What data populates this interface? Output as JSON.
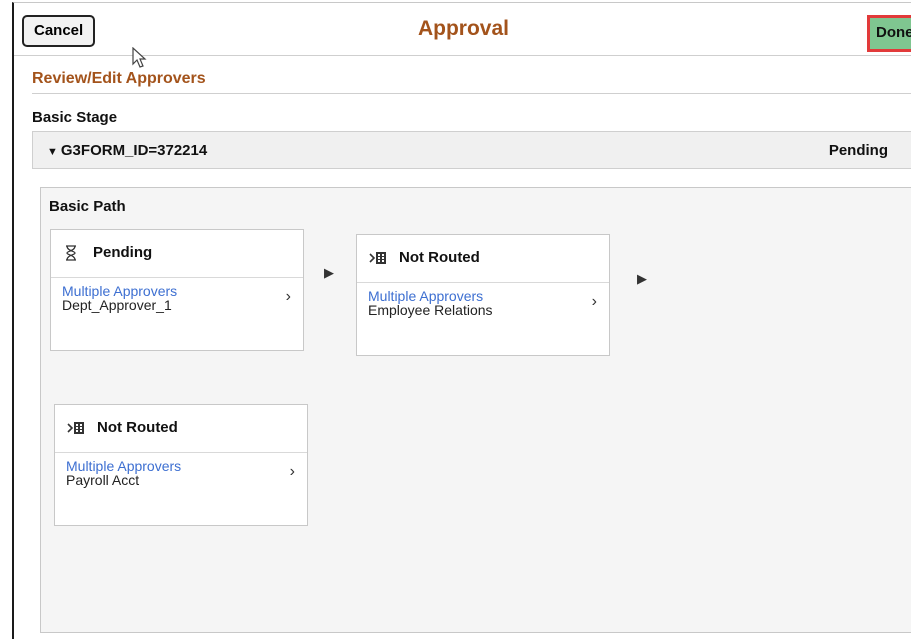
{
  "header": {
    "cancel_label": "Cancel",
    "title": "Approval",
    "done_label": "Done"
  },
  "section_title": "Review/Edit Approvers",
  "stage": {
    "label": "Basic Stage",
    "group": {
      "id_label": "G3FORM_ID=372214",
      "status": "Pending"
    },
    "path": {
      "title": "Basic Path",
      "steps": [
        {
          "status": "Pending",
          "icon": "hourglass-icon",
          "link": "Multiple Approvers",
          "approver": "Dept_Approver_1"
        },
        {
          "status": "Not Routed",
          "icon": "not-routed-icon",
          "link": "Multiple Approvers",
          "approver": "Employee Relations"
        },
        {
          "status": "Not Routed",
          "icon": "not-routed-icon",
          "link": "Multiple Approvers",
          "approver": "Payroll Acct"
        }
      ]
    }
  },
  "colors": {
    "title_accent": "#a3531b",
    "done_bg": "#7fc690",
    "done_highlight": "#e23a3a",
    "link": "#3d6fd1"
  }
}
